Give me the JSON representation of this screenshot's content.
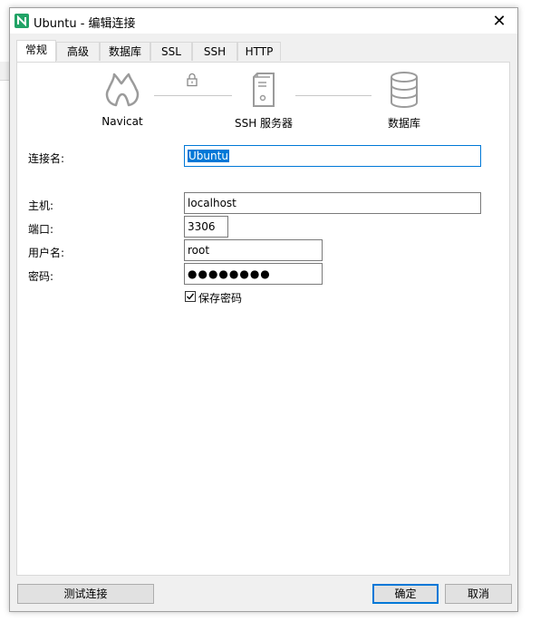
{
  "window": {
    "title": "Ubuntu - 编辑连接",
    "close_glyph": "✕"
  },
  "tabs": [
    {
      "label": "常规",
      "active": true
    },
    {
      "label": "高级",
      "active": false
    },
    {
      "label": "数据库",
      "active": false
    },
    {
      "label": "SSL",
      "active": false
    },
    {
      "label": "SSH",
      "active": false
    },
    {
      "label": "HTTP",
      "active": false
    }
  ],
  "diagram": {
    "navicat_label": "Navicat",
    "ssh_label": "SSH 服务器",
    "database_label": "数据库",
    "icons": [
      "navicat-logo-icon",
      "lock-icon",
      "server-icon",
      "database-icon"
    ]
  },
  "form": {
    "connection_name_label": "连接名:",
    "connection_name_value": "Ubuntu",
    "host_label": "主机:",
    "host_value": "localhost",
    "port_label": "端口:",
    "port_value": "3306",
    "username_label": "用户名:",
    "username_value": "root",
    "password_label": "密码:",
    "password_value": "●●●●●●●●",
    "save_password_label": "保存密码",
    "save_password_checked": true
  },
  "buttons": {
    "test": "测试连接",
    "ok": "确定",
    "cancel": "取消"
  },
  "colors": {
    "accent": "#0078d7",
    "app_icon": "#21a366"
  }
}
